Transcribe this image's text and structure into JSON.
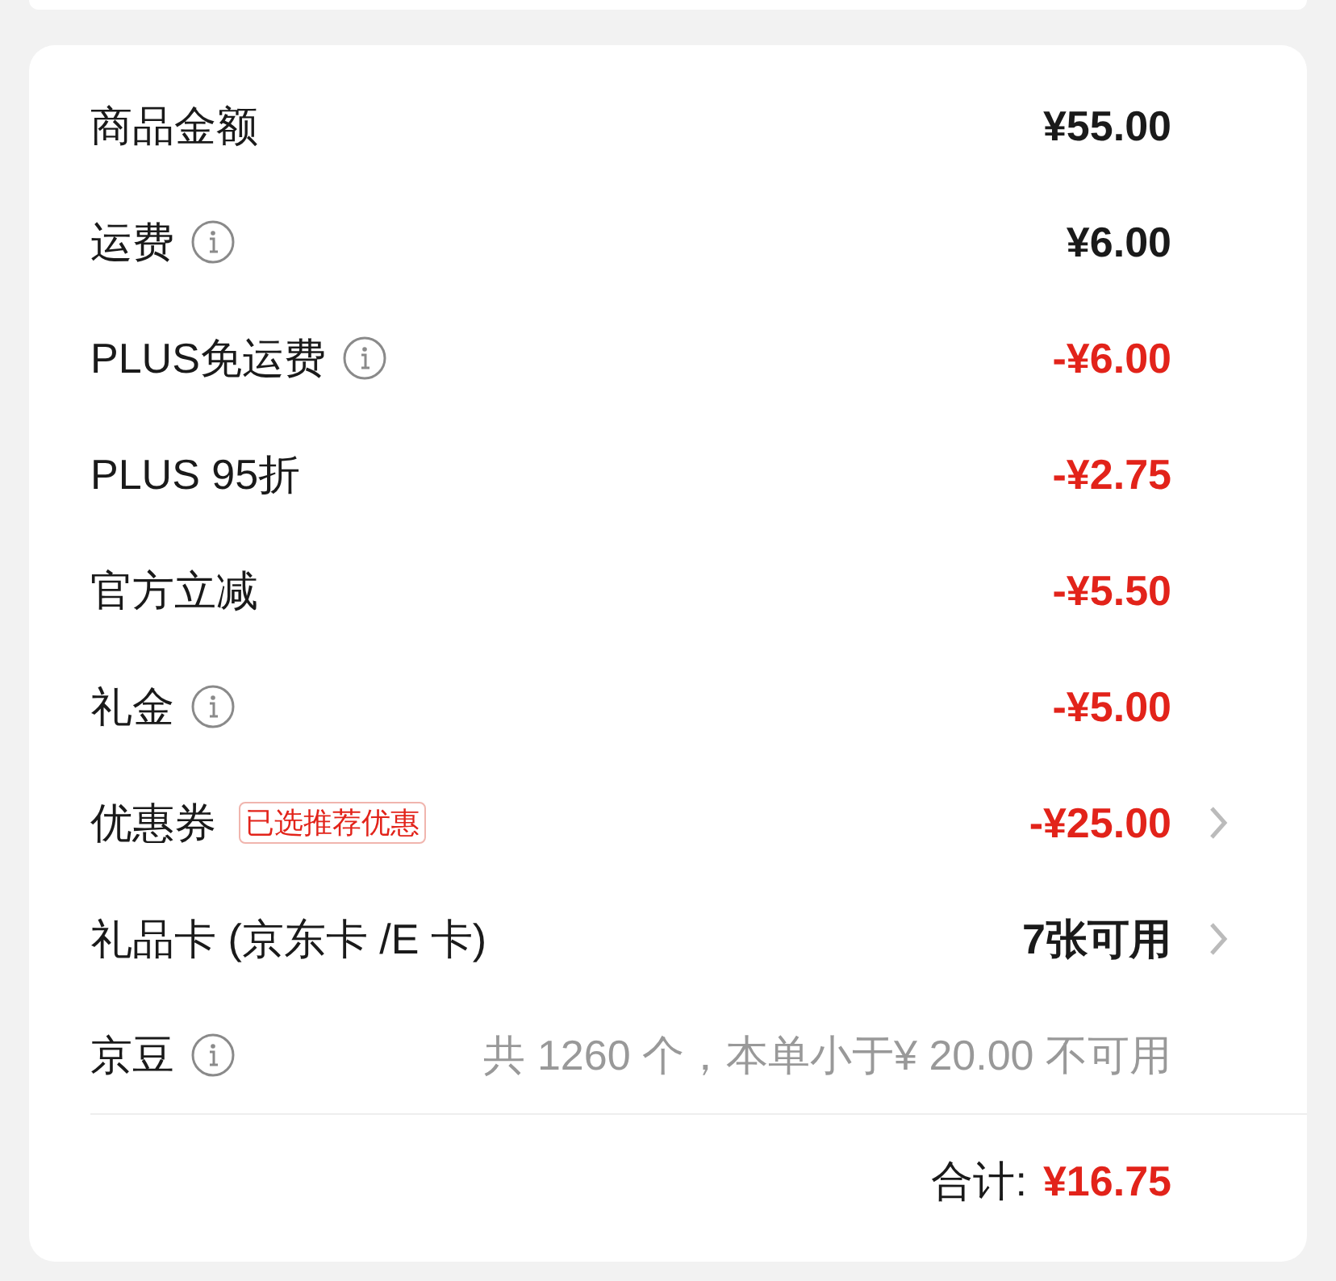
{
  "rows": [
    {
      "label": "商品金额",
      "info": false,
      "value": "¥55.00",
      "kind": "amount",
      "chevron": false
    },
    {
      "label": "运费",
      "info": true,
      "value": "¥6.00",
      "kind": "amount",
      "chevron": false
    },
    {
      "label": "PLUS免运费",
      "info": true,
      "value": "-¥6.00",
      "kind": "discount",
      "chevron": false
    },
    {
      "label": "PLUS 95折",
      "info": false,
      "value": "-¥2.75",
      "kind": "discount",
      "chevron": false
    },
    {
      "label": "官方立减",
      "info": false,
      "value": "-¥5.50",
      "kind": "discount",
      "chevron": false
    },
    {
      "label": "礼金",
      "info": true,
      "value": "-¥5.00",
      "kind": "discount",
      "chevron": false
    },
    {
      "label": "优惠券",
      "info": false,
      "badge": "已选推荐优惠",
      "value": "-¥25.00",
      "kind": "discount",
      "chevron": true
    },
    {
      "label": "礼品卡 (京东卡 /E 卡)",
      "info": false,
      "value": "7张可用",
      "kind": "amount",
      "chevron": true
    },
    {
      "label": "京豆",
      "info": true,
      "value": "共 1260 个，本单小于¥ 20.00 不可用",
      "kind": "muted",
      "chevron": false
    }
  ],
  "total": {
    "label": "合计:",
    "value": "¥16.75"
  }
}
